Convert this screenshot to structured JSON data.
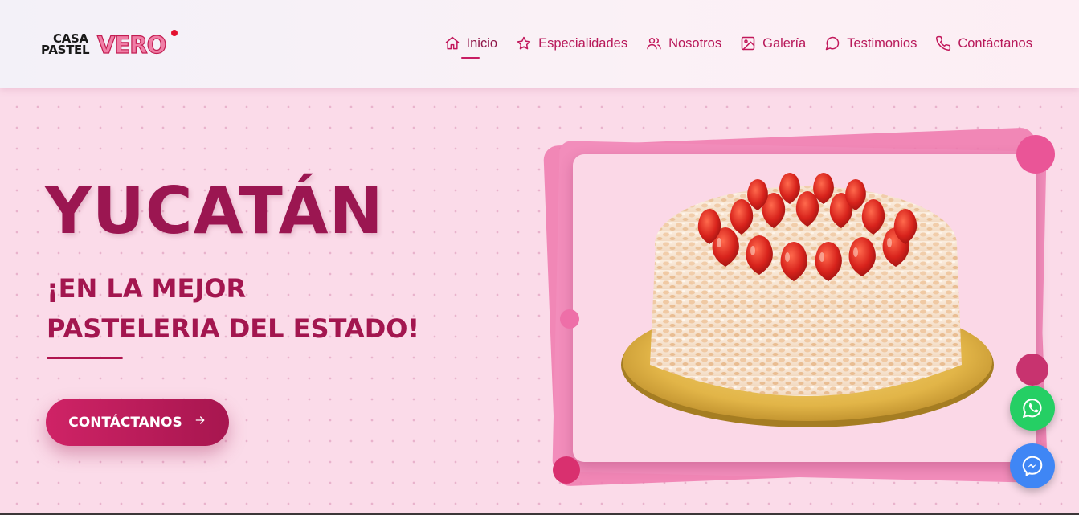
{
  "logo": {
    "line1": "CASA",
    "line2": "PASTEL",
    "brand": "VERO"
  },
  "nav": {
    "items": [
      {
        "label": "Inicio",
        "icon": "home-icon",
        "active": true
      },
      {
        "label": "Especialidades",
        "icon": "star-icon",
        "active": false
      },
      {
        "label": "Nosotros",
        "icon": "users-icon",
        "active": false
      },
      {
        "label": "Galería",
        "icon": "image-icon",
        "active": false
      },
      {
        "label": "Testimonios",
        "icon": "chat-icon",
        "active": false
      },
      {
        "label": "Contáctanos",
        "icon": "phone-icon",
        "active": false
      }
    ]
  },
  "hero": {
    "title": "YUCATÁN",
    "subtitle_line1": "¡EN LA MEJOR",
    "subtitle_line2": "PASTELERIA DEL ESTADO!",
    "cta_label": "CONTÁCTANOS",
    "cta_icon": "arrow-right-icon",
    "image": "strawberry-cake-photo"
  },
  "floating": {
    "whatsapp_icon": "whatsapp-icon",
    "messenger_icon": "messenger-icon"
  },
  "colors": {
    "brand_primary": "#c2185b",
    "brand_dark": "#9b1651",
    "background": "#fbdbe9",
    "frame_pink": "#f28dbb",
    "whatsapp": "#25cf64",
    "messenger": "#3f86f5"
  }
}
